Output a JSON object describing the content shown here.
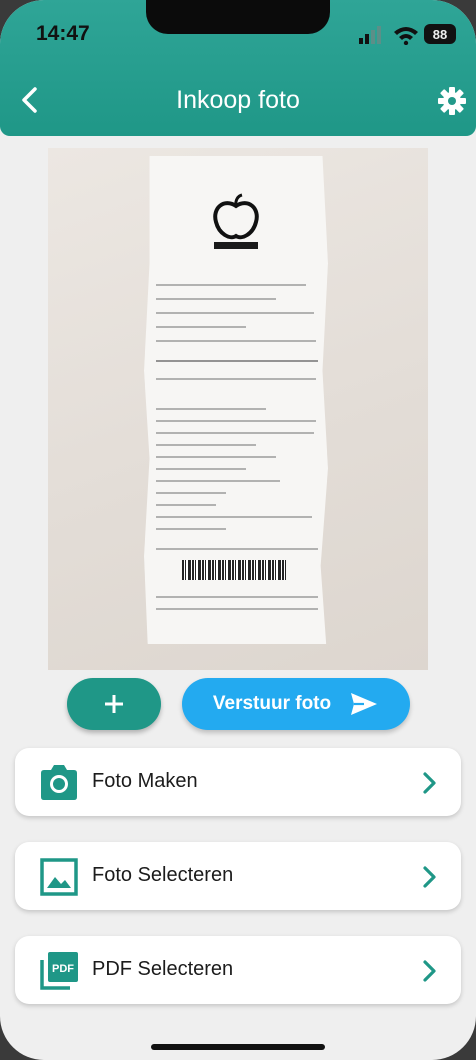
{
  "status_bar": {
    "time": "14:47",
    "battery": "88"
  },
  "header": {
    "title": "Inkoop foto"
  },
  "photo": {
    "alt": "Receipt photo"
  },
  "actions": {
    "add_symbol": "+",
    "send_label": "Verstuur foto"
  },
  "options": [
    {
      "label": "Foto Maken",
      "icon": "camera-icon"
    },
    {
      "label": "Foto Selecteren",
      "icon": "image-icon"
    },
    {
      "label": "PDF Selecteren",
      "icon": "pdf-icon",
      "icon_text": "PDF"
    }
  ],
  "colors": {
    "primary": "#1f9787",
    "send": "#23aaf0",
    "background": "#efefef"
  }
}
